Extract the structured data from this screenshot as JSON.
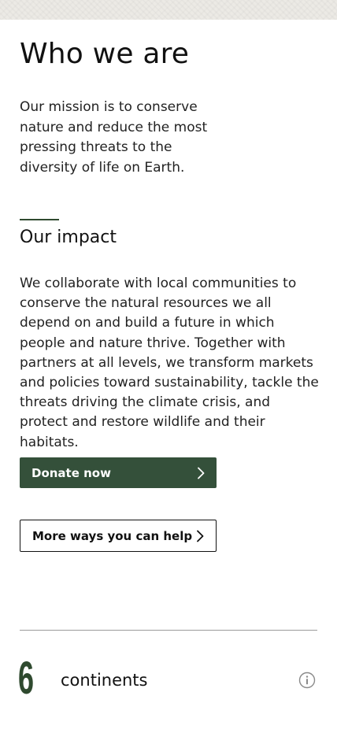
{
  "about": {
    "title": "Who we are",
    "mission": "Our mission is to conserve nature and reduce the most pressing threats to the diversity of life on Earth."
  },
  "impact": {
    "heading": "Our impact",
    "body": "We collaborate with local communities to conserve the natural resources we all depend on and build a future in which people and nature thrive. Together with partners at all levels, we transform markets and policies toward sustainability, tackle the threats driving the climate crisis, and protect and restore wildlife and their habitats."
  },
  "actions": {
    "donate_label": "Donate now",
    "more_label": "More ways you can help"
  },
  "stats": {
    "number": "6",
    "label": "continents"
  },
  "icons": {
    "chevron": "chevron-right-icon",
    "info": "info-icon"
  },
  "colors": {
    "brand_green": "#34503a",
    "accent_green": "#2f4a2f"
  }
}
